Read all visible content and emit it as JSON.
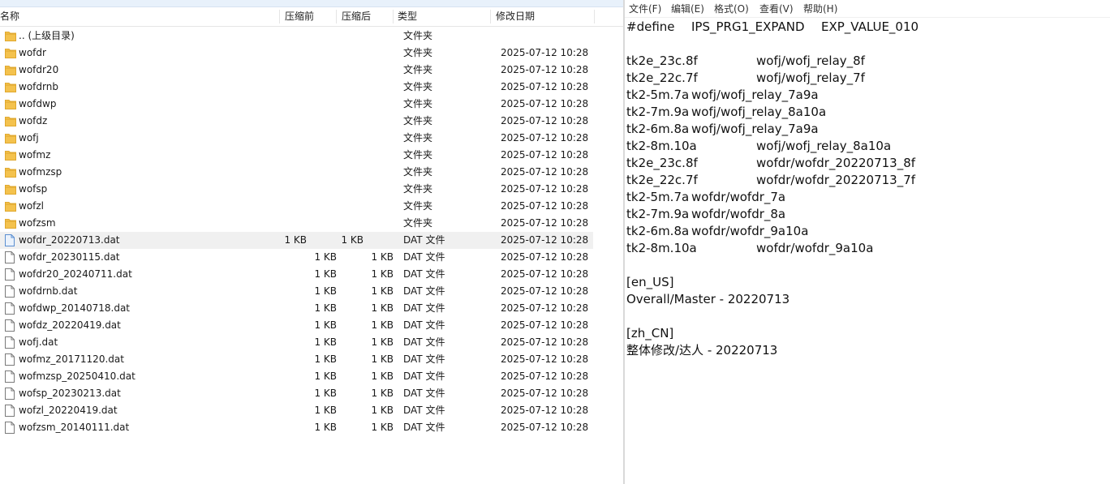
{
  "explorer": {
    "columns": {
      "name": "名称",
      "size_before": "压缩前",
      "size_after": "压缩后",
      "type": "类型",
      "modified": "修改日期"
    },
    "rows": [
      {
        "kind": "folder",
        "name": ".. (上级目录)",
        "size_before": "",
        "size_after": "",
        "type": "文件夹",
        "modified": ""
      },
      {
        "kind": "folder",
        "name": "wofdr",
        "size_before": "",
        "size_after": "",
        "type": "文件夹",
        "modified": "2025-07-12 10:28"
      },
      {
        "kind": "folder",
        "name": "wofdr20",
        "size_before": "",
        "size_after": "",
        "type": "文件夹",
        "modified": "2025-07-12 10:28"
      },
      {
        "kind": "folder",
        "name": "wofdrnb",
        "size_before": "",
        "size_after": "",
        "type": "文件夹",
        "modified": "2025-07-12 10:28"
      },
      {
        "kind": "folder",
        "name": "wofdwp",
        "size_before": "",
        "size_after": "",
        "type": "文件夹",
        "modified": "2025-07-12 10:28"
      },
      {
        "kind": "folder",
        "name": "wofdz",
        "size_before": "",
        "size_after": "",
        "type": "文件夹",
        "modified": "2025-07-12 10:28"
      },
      {
        "kind": "folder",
        "name": "wofj",
        "size_before": "",
        "size_after": "",
        "type": "文件夹",
        "modified": "2025-07-12 10:28"
      },
      {
        "kind": "folder",
        "name": "wofmz",
        "size_before": "",
        "size_after": "",
        "type": "文件夹",
        "modified": "2025-07-12 10:28"
      },
      {
        "kind": "folder",
        "name": "wofmzsp",
        "size_before": "",
        "size_after": "",
        "type": "文件夹",
        "modified": "2025-07-12 10:28"
      },
      {
        "kind": "folder",
        "name": "wofsp",
        "size_before": "",
        "size_after": "",
        "type": "文件夹",
        "modified": "2025-07-12 10:28"
      },
      {
        "kind": "folder",
        "name": "wofzl",
        "size_before": "",
        "size_after": "",
        "type": "文件夹",
        "modified": "2025-07-12 10:28"
      },
      {
        "kind": "folder",
        "name": "wofzsm",
        "size_before": "",
        "size_after": "",
        "type": "文件夹",
        "modified": "2025-07-12 10:28"
      },
      {
        "kind": "file",
        "selected": true,
        "name": "wofdr_20220713.dat",
        "size_before": "1 KB",
        "size_after": "1 KB",
        "type": "DAT 文件",
        "modified": "2025-07-12 10:28"
      },
      {
        "kind": "file",
        "name": "wofdr_20230115.dat",
        "size_before": "1 KB",
        "size_after": "1 KB",
        "type": "DAT 文件",
        "modified": "2025-07-12 10:28"
      },
      {
        "kind": "file",
        "name": "wofdr20_20240711.dat",
        "size_before": "1 KB",
        "size_after": "1 KB",
        "type": "DAT 文件",
        "modified": "2025-07-12 10:28"
      },
      {
        "kind": "file",
        "name": "wofdrnb.dat",
        "size_before": "1 KB",
        "size_after": "1 KB",
        "type": "DAT 文件",
        "modified": "2025-07-12 10:28"
      },
      {
        "kind": "file",
        "name": "wofdwp_20140718.dat",
        "size_before": "1 KB",
        "size_after": "1 KB",
        "type": "DAT 文件",
        "modified": "2025-07-12 10:28"
      },
      {
        "kind": "file",
        "name": "wofdz_20220419.dat",
        "size_before": "1 KB",
        "size_after": "1 KB",
        "type": "DAT 文件",
        "modified": "2025-07-12 10:28"
      },
      {
        "kind": "file",
        "name": "wofj.dat",
        "size_before": "1 KB",
        "size_after": "1 KB",
        "type": "DAT 文件",
        "modified": "2025-07-12 10:28"
      },
      {
        "kind": "file",
        "name": "wofmz_20171120.dat",
        "size_before": "1 KB",
        "size_after": "1 KB",
        "type": "DAT 文件",
        "modified": "2025-07-12 10:28"
      },
      {
        "kind": "file",
        "name": "wofmzsp_20250410.dat",
        "size_before": "1 KB",
        "size_after": "1 KB",
        "type": "DAT 文件",
        "modified": "2025-07-12 10:28"
      },
      {
        "kind": "file",
        "name": "wofsp_20230213.dat",
        "size_before": "1 KB",
        "size_after": "1 KB",
        "type": "DAT 文件",
        "modified": "2025-07-12 10:28"
      },
      {
        "kind": "file",
        "name": "wofzl_20220419.dat",
        "size_before": "1 KB",
        "size_after": "1 KB",
        "type": "DAT 文件",
        "modified": "2025-07-12 10:28"
      },
      {
        "kind": "file",
        "name": "wofzsm_20140111.dat",
        "size_before": "1 KB",
        "size_after": "1 KB",
        "type": "DAT 文件",
        "modified": "2025-07-12 10:28"
      }
    ]
  },
  "notepad": {
    "menu": [
      "文件(F)",
      "编辑(E)",
      "格式(O)",
      "查看(V)",
      "帮助(H)"
    ],
    "lines": [
      {
        "parts": [
          "#define",
          "IPS_PRG1_EXPAND",
          "EXP_VALUE_010"
        ]
      },
      {
        "parts": [
          ""
        ]
      },
      {
        "parts": [
          "tk2e_23c.8f",
          "wofj/wofj_relay_8f"
        ],
        "tab": true
      },
      {
        "parts": [
          "tk2e_22c.7f",
          "wofj/wofj_relay_7f"
        ],
        "tab": true
      },
      {
        "parts": [
          "tk2-5m.7a",
          "wofj/wofj_relay_7a9a"
        ]
      },
      {
        "parts": [
          "tk2-7m.9a",
          "wofj/wofj_relay_8a10a"
        ]
      },
      {
        "parts": [
          "tk2-6m.8a",
          "wofj/wofj_relay_7a9a"
        ]
      },
      {
        "parts": [
          "tk2-8m.10a",
          "wofj/wofj_relay_8a10a"
        ],
        "tab": true
      },
      {
        "parts": [
          "tk2e_23c.8f",
          "wofdr/wofdr_20220713_8f"
        ],
        "tab": true
      },
      {
        "parts": [
          "tk2e_22c.7f",
          "wofdr/wofdr_20220713_7f"
        ],
        "tab": true
      },
      {
        "parts": [
          "tk2-5m.7a",
          "wofdr/wofdr_7a"
        ]
      },
      {
        "parts": [
          "tk2-7m.9a",
          "wofdr/wofdr_8a"
        ]
      },
      {
        "parts": [
          "tk2-6m.8a",
          "wofdr/wofdr_9a10a"
        ]
      },
      {
        "parts": [
          "tk2-8m.10a",
          "wofdr/wofdr_9a10a"
        ],
        "tab": true
      },
      {
        "parts": [
          ""
        ]
      },
      {
        "parts": [
          "[en_US]"
        ]
      },
      {
        "parts": [
          "Overall/Master - 20220713"
        ]
      },
      {
        "parts": [
          ""
        ]
      },
      {
        "parts": [
          "[zh_CN]"
        ]
      },
      {
        "parts": [
          "整体修改/达人 - 20220713"
        ]
      }
    ]
  },
  "colors": {
    "folder": "#f4c24d",
    "folder_dark": "#e0a82e",
    "file_border": "#7a7a7a",
    "selected_file_border": "#5b8fd1",
    "selection_bg": "#f0f0f0"
  }
}
